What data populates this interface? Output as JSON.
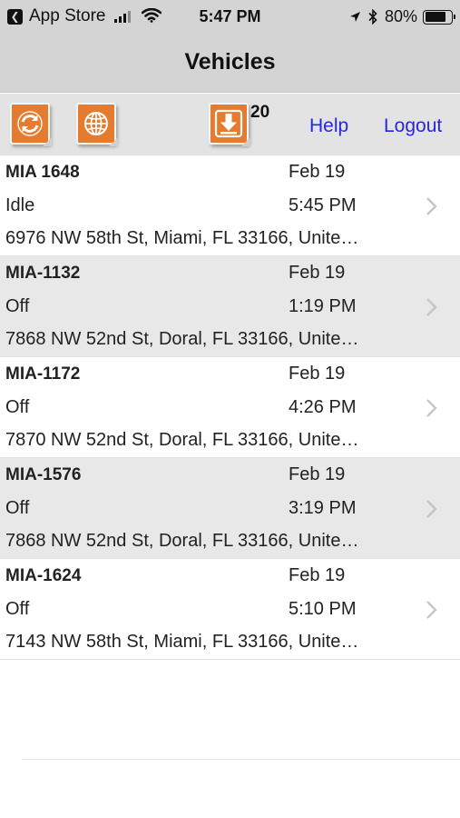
{
  "status_bar": {
    "back_app": "App Store",
    "time": "5:47 PM",
    "battery_pct": "80%",
    "battery_level": 0.8,
    "icons": [
      "back-arrow-icon",
      "signal-icon",
      "wifi-icon",
      "location-icon",
      "bluetooth-icon",
      "battery-icon"
    ]
  },
  "nav": {
    "title": "Vehicles"
  },
  "toolbar": {
    "refresh_icon": "refresh-icon",
    "map_icon": "globe-icon",
    "download_icon": "download-icon",
    "download_count": "20",
    "help_label": "Help",
    "logout_label": "Logout"
  },
  "colors": {
    "accent": "#e57b2e",
    "link": "#2727e0",
    "bar": "#d4d4d4",
    "row_alt": "#e8e8e8"
  },
  "vehicles": [
    {
      "name": "MIA 1648",
      "date": "Feb 19",
      "status": "Idle",
      "time": "5:45 PM",
      "address": "6976 NW 58th St, Miami, FL 33166, Unite…"
    },
    {
      "name": "MIA-1132",
      "date": "Feb 19",
      "status": "Off",
      "time": "1:19 PM",
      "address": "7868 NW 52nd St, Doral, FL 33166, Unite…"
    },
    {
      "name": "MIA-1172",
      "date": "Feb 19",
      "status": "Off",
      "time": "4:26 PM",
      "address": "7870 NW 52nd St, Doral, FL 33166, Unite…"
    },
    {
      "name": "MIA-1576",
      "date": "Feb 19",
      "status": "Off",
      "time": "3:19 PM",
      "address": "7868 NW 52nd St, Doral, FL 33166, Unite…"
    },
    {
      "name": "MIA-1624",
      "date": "Feb 19",
      "status": "Off",
      "time": "5:10 PM",
      "address": "7143 NW 58th St, Miami, FL 33166, Unite…"
    }
  ]
}
